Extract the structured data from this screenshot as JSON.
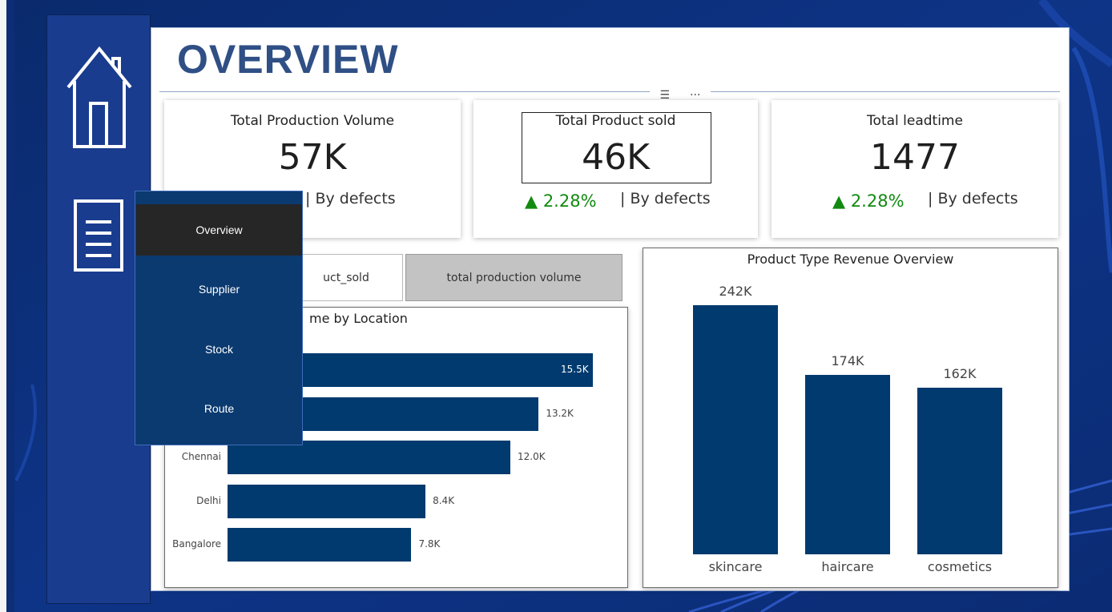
{
  "header": {
    "title": "OVERVIEW"
  },
  "sidebar": {
    "icons": [
      {
        "name": "home-icon"
      },
      {
        "name": "document-icon"
      }
    ]
  },
  "nav_menu": {
    "items": [
      {
        "label": "Overview",
        "active": true
      },
      {
        "label": "Supplier",
        "active": false
      },
      {
        "label": "Stock",
        "active": false
      },
      {
        "label": "Route",
        "active": false
      }
    ]
  },
  "visual_header": {
    "filter_icon": "filter-icon",
    "more_icon": "more-options-icon"
  },
  "kpis": [
    {
      "title": "Total Production Volume",
      "value": "57K",
      "delta": "",
      "subtitle": "| By defects"
    },
    {
      "title": "Total Product sold",
      "value": "46K",
      "delta": "▲ 2.28%",
      "subtitle": "| By defects"
    },
    {
      "title": "Total leadtime",
      "value": "1477",
      "delta": "▲ 2.28%",
      "subtitle": "| By defects"
    }
  ],
  "slicers": [
    {
      "label": "uct_sold",
      "selected": false
    },
    {
      "label": "total production volume",
      "selected": true
    }
  ],
  "colors": {
    "bar": "#003a6e",
    "positive": "#118a0f",
    "sidebar": "#1a3c8f",
    "nav_active": "#262626",
    "title": "#2f4f85"
  },
  "chart_data": [
    {
      "type": "bar",
      "orientation": "horizontal",
      "title": "me by Location",
      "categories": [
        "",
        "",
        "Chennai",
        "Delhi",
        "Bangalore"
      ],
      "values": [
        15.5,
        13.2,
        12.0,
        8.4,
        7.8
      ],
      "value_labels": [
        "15.5K",
        "13.2K",
        "12.0K",
        "8.4K",
        "7.8K"
      ],
      "unit": "K",
      "xlim": [
        0,
        16.5
      ]
    },
    {
      "type": "bar",
      "orientation": "vertical",
      "title": "Product Type Revenue Overview",
      "categories": [
        "skincare",
        "haircare",
        "cosmetics"
      ],
      "values": [
        242,
        174,
        162
      ],
      "value_labels": [
        "242K",
        "174K",
        "162K"
      ],
      "unit": "K",
      "ylim": [
        0,
        242
      ]
    }
  ]
}
